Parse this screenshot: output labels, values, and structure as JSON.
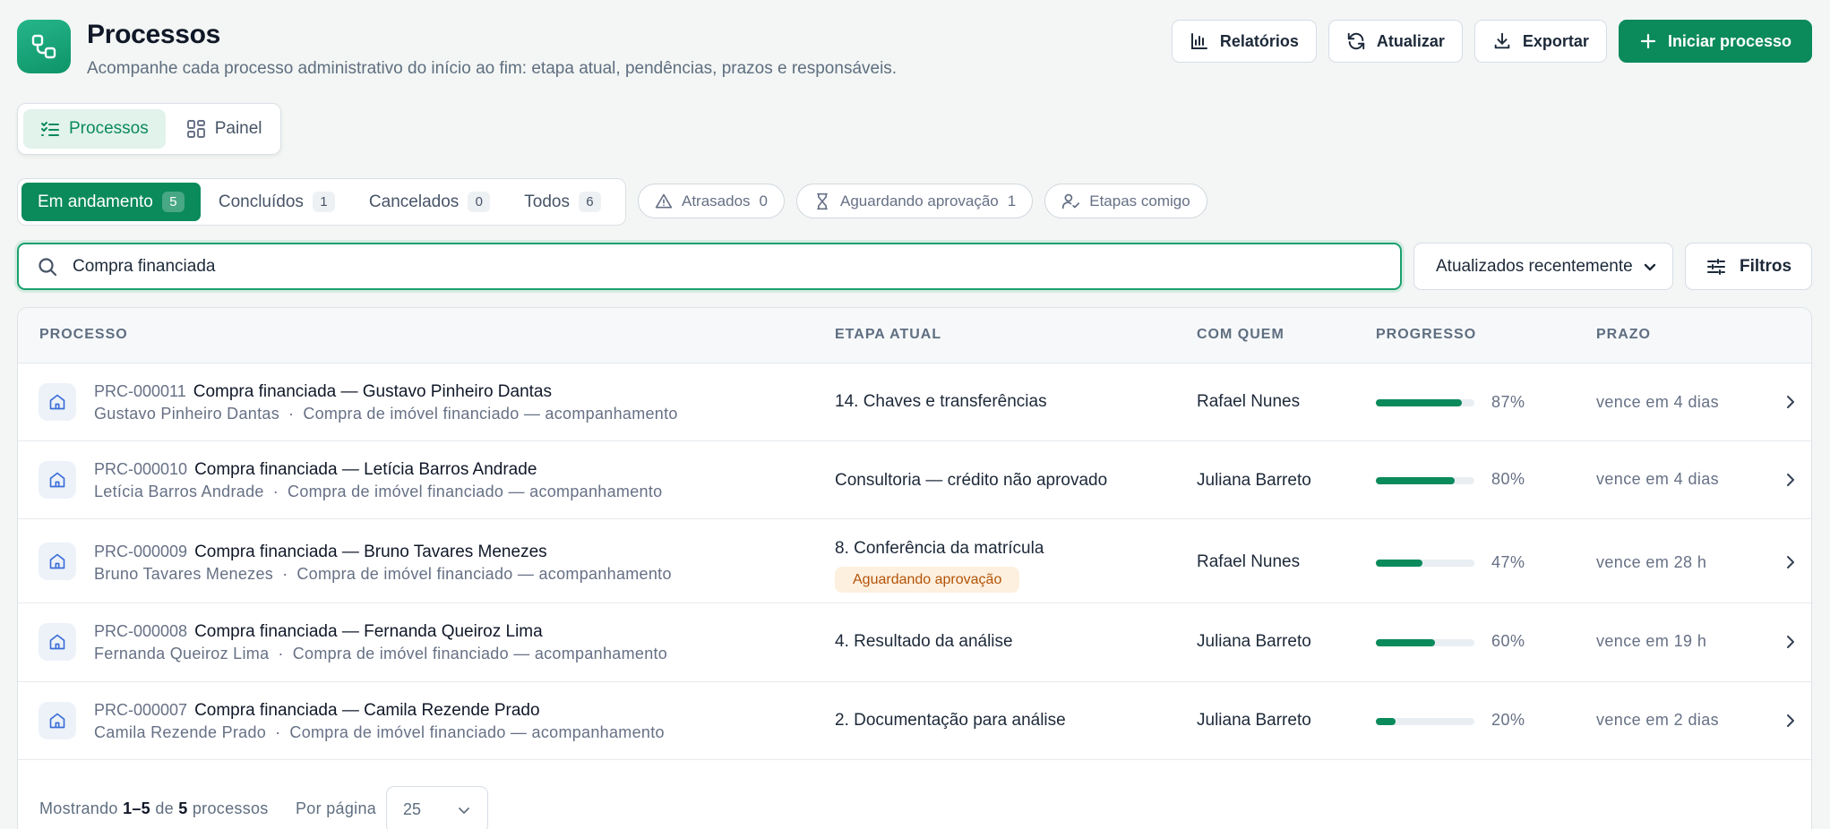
{
  "header": {
    "title": "Processos",
    "subtitle": "Acompanhe cada processo administrativo do início ao fim: etapa atual, pendências, prazos e responsáveis.",
    "actions": {
      "reports": "Relatórios",
      "refresh": "Atualizar",
      "export": "Exportar",
      "start": "Iniciar processo"
    }
  },
  "views": {
    "processes": "Processos",
    "panel": "Painel"
  },
  "status_tabs": [
    {
      "label": "Em andamento",
      "count": "5"
    },
    {
      "label": "Concluídos",
      "count": "1"
    },
    {
      "label": "Cancelados",
      "count": "0"
    },
    {
      "label": "Todos",
      "count": "6"
    }
  ],
  "chips": {
    "late": {
      "label": "Atrasados",
      "count": "0"
    },
    "approval": {
      "label": "Aguardando aprovação",
      "count": "1"
    },
    "mine": {
      "label": "Etapas comigo"
    }
  },
  "search": {
    "value": "Compra financiada"
  },
  "sort": {
    "selected": "Atualizados recentemente"
  },
  "filters_label": "Filtros",
  "table": {
    "columns": {
      "process": "PROCESSO",
      "stage": "ETAPA ATUAL",
      "assignee": "COM QUEM",
      "progress": "PROGRESSO",
      "deadline": "PRAZO"
    },
    "rows": [
      {
        "code": "PRC-000011",
        "title": "Compra financiada — Gustavo Pinheiro Dantas",
        "client": "Gustavo Pinheiro Dantas",
        "type": "Compra de imóvel financiado — acompanhamento",
        "stage": "14. Chaves e transferências",
        "badge": "",
        "assignee": "Rafael Nunes",
        "progress": 87,
        "progress_label": "87%",
        "deadline": "vence em 4 dias"
      },
      {
        "code": "PRC-000010",
        "title": "Compra financiada — Letícia Barros Andrade",
        "client": "Letícia Barros Andrade",
        "type": "Compra de imóvel financiado — acompanhamento",
        "stage": "Consultoria — crédito não aprovado",
        "badge": "",
        "assignee": "Juliana Barreto",
        "progress": 80,
        "progress_label": "80%",
        "deadline": "vence em 4 dias"
      },
      {
        "code": "PRC-000009",
        "title": "Compra financiada — Bruno Tavares Menezes",
        "client": "Bruno Tavares Menezes",
        "type": "Compra de imóvel financiado — acompanhamento",
        "stage": "8. Conferência da matrícula",
        "badge": "Aguardando aprovação",
        "assignee": "Rafael Nunes",
        "progress": 47,
        "progress_label": "47%",
        "deadline": "vence em 28 h"
      },
      {
        "code": "PRC-000008",
        "title": "Compra financiada — Fernanda Queiroz Lima",
        "client": "Fernanda Queiroz Lima",
        "type": "Compra de imóvel financiado — acompanhamento",
        "stage": "4. Resultado da análise",
        "badge": "",
        "assignee": "Juliana Barreto",
        "progress": 60,
        "progress_label": "60%",
        "deadline": "vence em 19 h"
      },
      {
        "code": "PRC-000007",
        "title": "Compra financiada — Camila Rezende Prado",
        "client": "Camila Rezende Prado",
        "type": "Compra de imóvel financiado — acompanhamento",
        "stage": "2. Documentação para análise",
        "badge": "",
        "assignee": "Juliana Barreto",
        "progress": 20,
        "progress_label": "20%",
        "deadline": "vence em 2 dias"
      }
    ]
  },
  "footer": {
    "showing_prefix": "Mostrando",
    "range": "1–5",
    "of": "de",
    "total": "5",
    "unit": "processos",
    "per_page_label": "Por página",
    "per_page_value": "25"
  },
  "colors": {
    "accent": "#0b8a5c",
    "badge_bg": "#fdf0de",
    "badge_text": "#b45309"
  },
  "icons": [
    "flow-icon",
    "bar-chart-icon",
    "refresh-icon",
    "download-icon",
    "plus-icon",
    "list-check-icon",
    "grid-icon",
    "warning-icon",
    "hourglass-icon",
    "user-check-icon",
    "search-icon",
    "chevron-down-icon",
    "sliders-icon",
    "home-icon",
    "chevron-right-icon"
  ]
}
